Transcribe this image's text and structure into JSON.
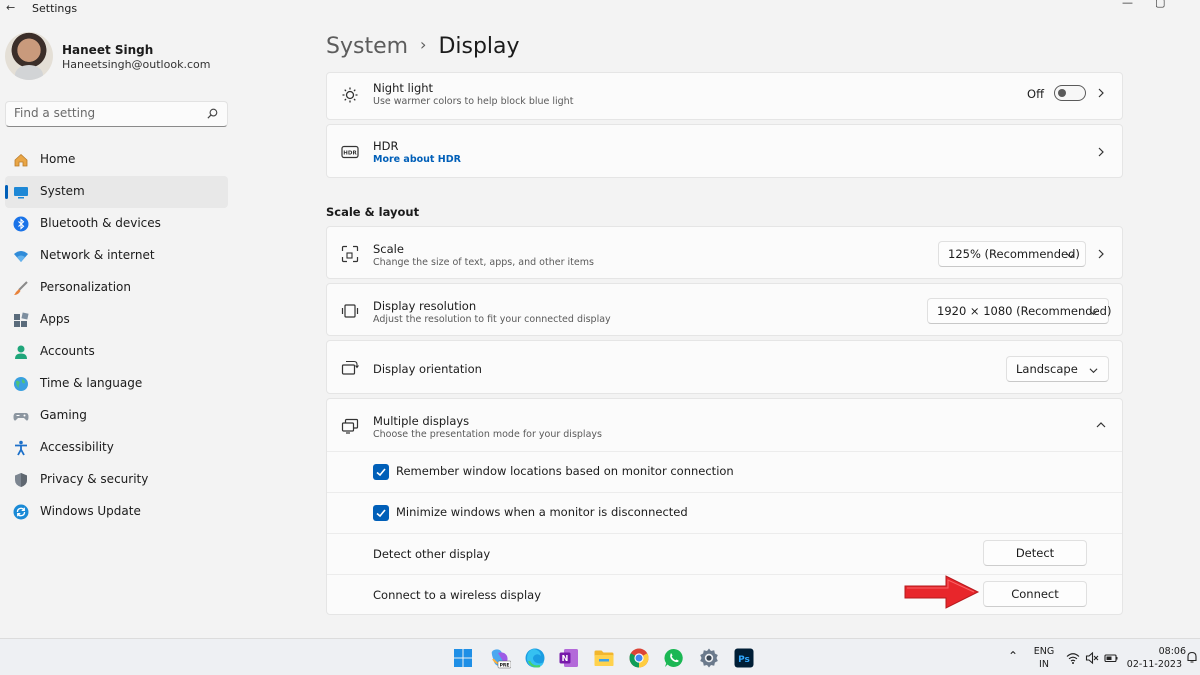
{
  "window": {
    "title": "Settings",
    "back_glyph": "←",
    "minimize_glyph": "—",
    "maximize_glyph": "▢"
  },
  "profile": {
    "name": "Haneet Singh",
    "email": "Haneetsingh@outlook.com"
  },
  "search": {
    "placeholder": "Find a setting"
  },
  "nav": {
    "items": [
      {
        "label": "Home",
        "icon": "home-icon"
      },
      {
        "label": "System",
        "icon": "system-icon",
        "active": true
      },
      {
        "label": "Bluetooth & devices",
        "icon": "bluetooth-icon"
      },
      {
        "label": "Network & internet",
        "icon": "wifi-icon"
      },
      {
        "label": "Personalization",
        "icon": "brush-icon"
      },
      {
        "label": "Apps",
        "icon": "apps-icon"
      },
      {
        "label": "Accounts",
        "icon": "person-icon"
      },
      {
        "label": "Time & language",
        "icon": "globe-icon"
      },
      {
        "label": "Gaming",
        "icon": "controller-icon"
      },
      {
        "label": "Accessibility",
        "icon": "accessibility-icon"
      },
      {
        "label": "Privacy & security",
        "icon": "shield-icon"
      },
      {
        "label": "Windows Update",
        "icon": "update-icon"
      }
    ]
  },
  "breadcrumb": {
    "parent": "System",
    "separator": "›",
    "current": "Display"
  },
  "night_light": {
    "title": "Night light",
    "subtitle": "Use warmer colors to help block blue light",
    "state_label": "Off"
  },
  "hdr": {
    "title": "HDR",
    "link": "More about HDR"
  },
  "scale_layout": {
    "heading": "Scale & layout",
    "scale": {
      "title": "Scale",
      "subtitle": "Change the size of text, apps, and other items",
      "value": "125% (Recommended)"
    },
    "resolution": {
      "title": "Display resolution",
      "subtitle": "Adjust the resolution to fit your connected display",
      "value": "1920 × 1080 (Recommended)"
    },
    "orientation": {
      "title": "Display orientation",
      "value": "Landscape"
    }
  },
  "multiple_displays": {
    "title": "Multiple displays",
    "subtitle": "Choose the presentation mode for your displays",
    "remember_label": "Remember window locations based on monitor connection",
    "minimize_label": "Minimize windows when a monitor is disconnected",
    "detect_label": "Detect other display",
    "detect_button": "Detect",
    "connect_label": "Connect to a wireless display",
    "connect_button": "Connect"
  },
  "taskbar": {
    "apps": [
      "start-icon",
      "copilot-icon",
      "edge-icon",
      "onenote-icon",
      "file-explorer-icon",
      "chrome-icon",
      "whatsapp-icon",
      "settings-icon",
      "photoshop-icon"
    ],
    "tray": {
      "lang_top": "ENG",
      "lang_bottom": "IN",
      "time": "08:06",
      "date": "02-11-2023",
      "overflow_glyph": "⌃"
    },
    "app_labels": {
      "onenote": "N",
      "photoshop": "Ps",
      "copilot": "PRE"
    }
  },
  "colors": {
    "accent": "#005fb8",
    "arrow": "#e8262b"
  }
}
